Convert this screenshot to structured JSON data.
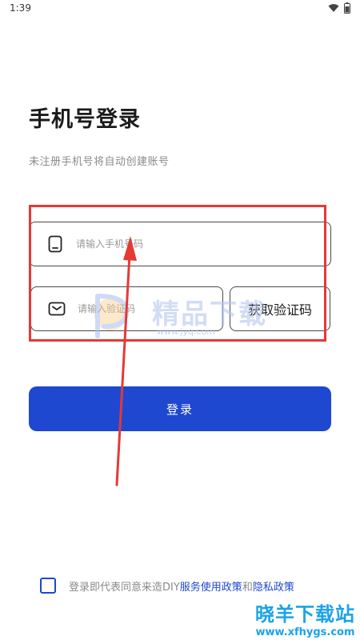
{
  "status_bar": {
    "time": "1:39",
    "icons": [
      "wifi-icon",
      "battery-icon"
    ]
  },
  "login": {
    "title": "手机号登录",
    "subtitle": "未注册手机号将自动创建账号",
    "phone_placeholder": "请输入手机号码",
    "code_placeholder": "请输入验证码",
    "get_code_label": "获取验证码",
    "login_label": "登录"
  },
  "terms": {
    "prefix": "登录即代表同意来造DIY ",
    "service_policy": "服务使用政策",
    "and": " 和",
    "privacy_policy": "隐私政策"
  },
  "watermark": {
    "center_text": "精品下载",
    "center_url": "www.jyq.com",
    "corner_title": "晓羊下载站",
    "corner_url": "www.xfhygs.com"
  },
  "colors": {
    "accent": "#1e48d0",
    "annotation": "#e53935",
    "watermark": "#1aa3e6"
  }
}
